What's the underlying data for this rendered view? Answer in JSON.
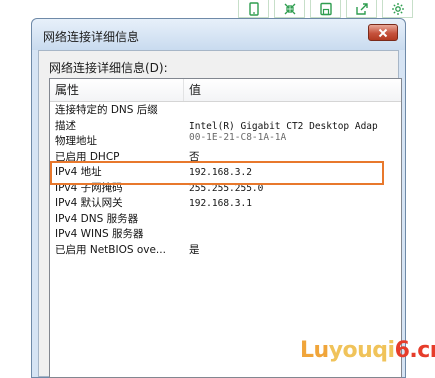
{
  "toolbar": {
    "icons": [
      "phone-icon",
      "shrink-icon",
      "save-icon",
      "share-icon",
      "gear-icon"
    ]
  },
  "dialog": {
    "title": "网络连接详细信息",
    "close_icon": "close-icon",
    "group_label": "网络连接详细信息(D):",
    "columns": {
      "property": "属性",
      "value": "值"
    },
    "rows": [
      {
        "property": "连接特定的 DNS 后缀",
        "value": ""
      },
      {
        "property": "描述",
        "value": "Intel(R) Gigabit CT2 Desktop Adap"
      },
      {
        "property": "物理地址",
        "value": "00-1E-21-C8-1A-1A"
      },
      {
        "property": "已启用 DHCP",
        "value": "否"
      },
      {
        "property": "IPv4 地址",
        "value": "192.168.3.2"
      },
      {
        "property": "IPv4 子网掩码",
        "value": "255.255.255.0"
      },
      {
        "property": "IPv4 默认网关",
        "value": "192.168.3.1"
      },
      {
        "property": "IPv4 DNS 服务器",
        "value": ""
      },
      {
        "property": "IPv4 WINS 服务器",
        "value": ""
      },
      {
        "property": "已启用 NetBIOS ove...",
        "value": "是"
      }
    ],
    "highlight_color": "#e8782c"
  },
  "watermark": {
    "part_a": "Lu",
    "part_b": "youqi",
    "part_c": "6.cn"
  }
}
